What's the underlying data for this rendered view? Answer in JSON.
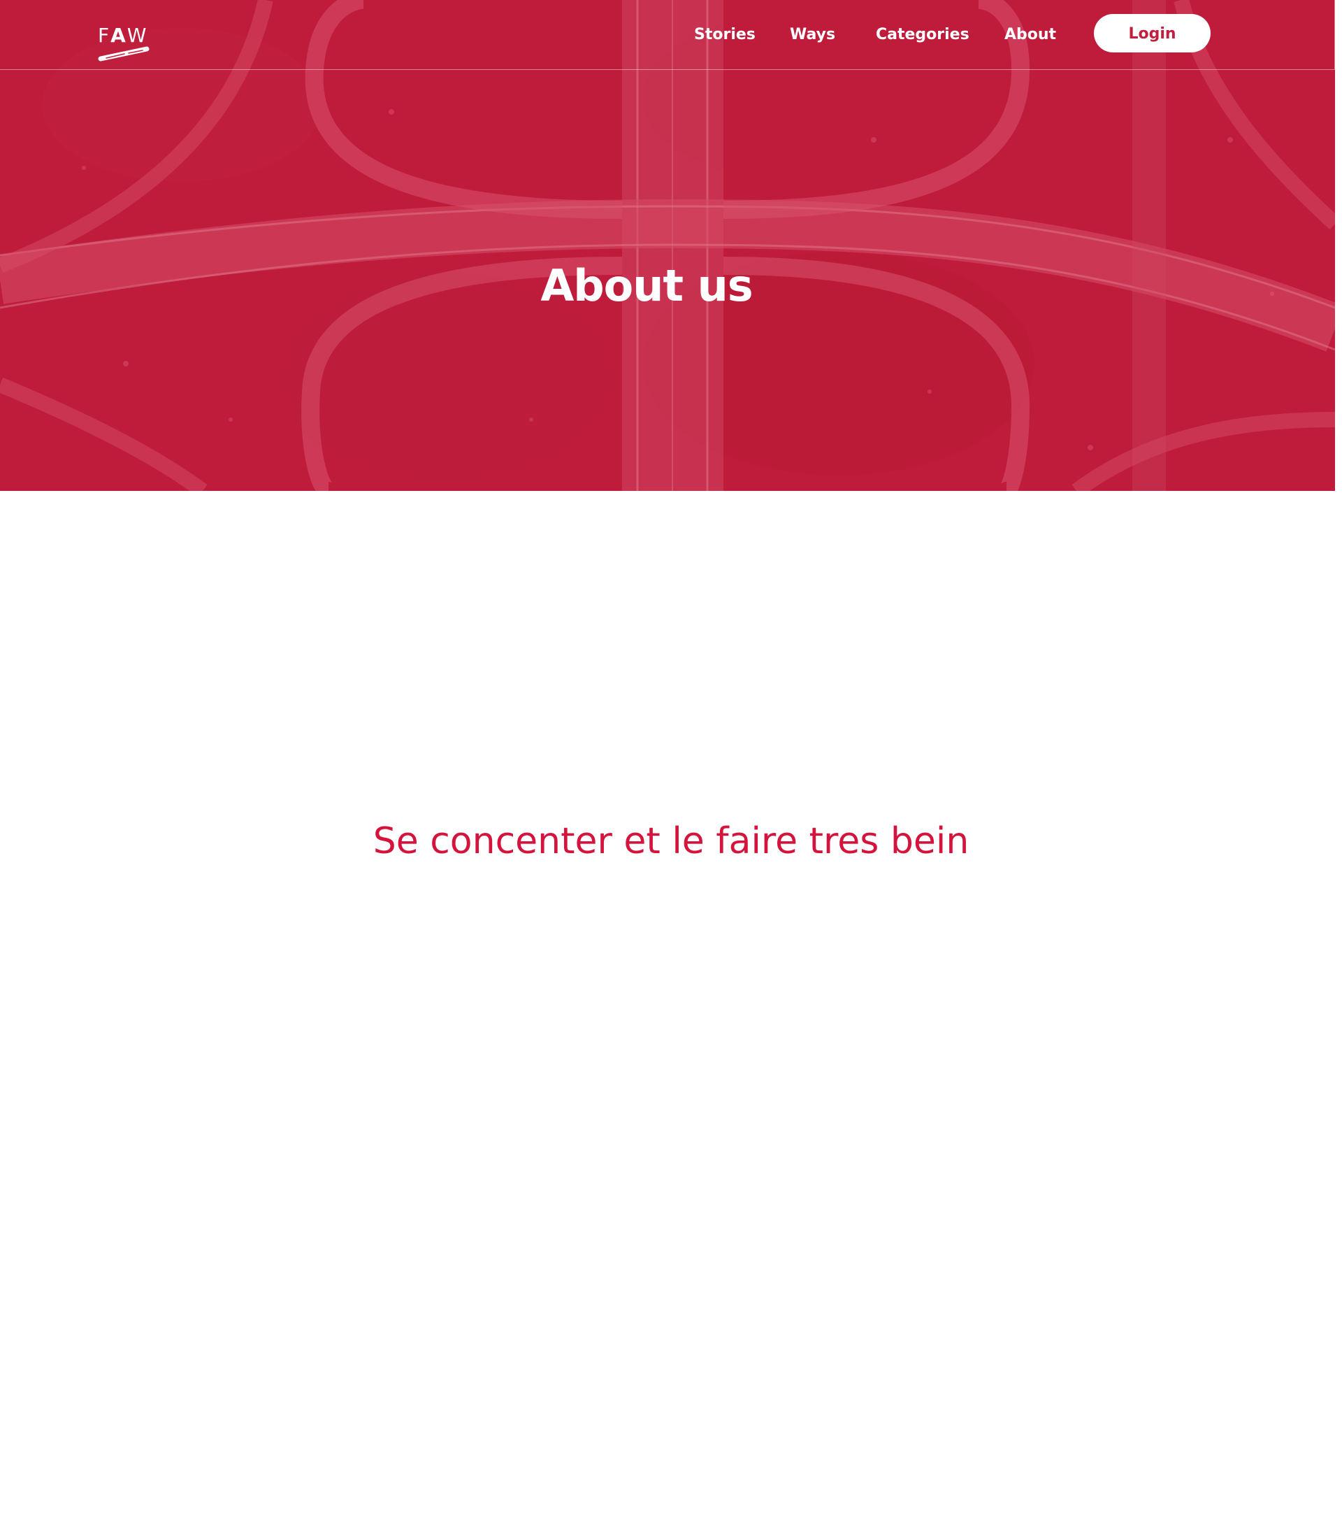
{
  "brand": {
    "logo_prefix": "F",
    "logo_mark": "A",
    "logo_suffix": "W"
  },
  "nav": {
    "items": [
      {
        "label": "Stories"
      },
      {
        "label": "Ways"
      },
      {
        "label": "Categories"
      },
      {
        "label": "About"
      }
    ],
    "login_label": "Login"
  },
  "hero": {
    "title": "About us",
    "overlay_color": "#c41e3e"
  },
  "main": {
    "tagline": "Se concenter et le faire tres bein",
    "tagline_color": "#d4143c"
  },
  "icons": {
    "logo_swoosh": "swoosh-icon"
  }
}
